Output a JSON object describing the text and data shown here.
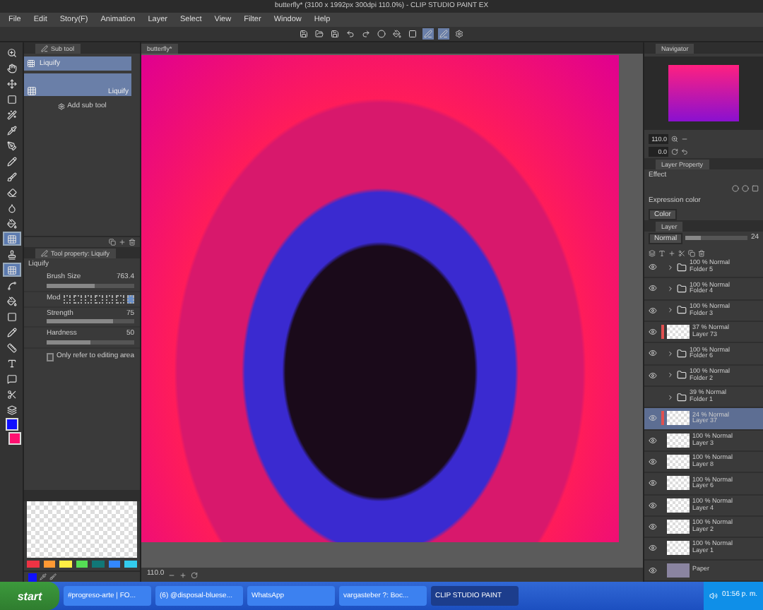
{
  "window": {
    "title": "butterfly* (3100 x 1992px 300dpi 110.0%) - CLIP STUDIO PAINT EX"
  },
  "menu": [
    "File",
    "Edit",
    "Story(F)",
    "Animation",
    "Layer",
    "Select",
    "View",
    "Filter",
    "Window",
    "Help"
  ],
  "tools": [
    {
      "selected": false
    },
    {
      "selected": false
    },
    {
      "selected": false
    },
    {
      "selected": false
    },
    {
      "selected": false
    },
    {
      "selected": false
    },
    {
      "selected": false
    },
    {
      "selected": false
    },
    {
      "selected": false
    },
    {
      "selected": false
    },
    {
      "selected": false
    },
    {
      "selected": false
    },
    {
      "selected": true
    },
    {
      "selected": false
    },
    {
      "selected": true
    },
    {
      "selected": false
    },
    {
      "selected": false
    },
    {
      "selected": false
    },
    {
      "selected": false
    },
    {
      "selected": false
    },
    {
      "selected": false
    },
    {
      "selected": false
    },
    {
      "selected": false
    },
    {
      "selected": false
    }
  ],
  "color_swatches": [
    {
      "kind": "main",
      "color": "#1010ff"
    },
    {
      "kind": "sub",
      "color": "#ff1070"
    }
  ],
  "sub_tool": {
    "tab": "Sub tool",
    "items": [
      {
        "kind": "row",
        "label": "Liquify",
        "selected": true
      },
      {
        "kind": "large",
        "label": "Liquify",
        "selected": true
      }
    ],
    "add_label": "Add sub tool"
  },
  "tool_property": {
    "tab": "Tool property: Liquify",
    "name": "Liquify",
    "properties": [
      {
        "kind": "slider",
        "label": "Brush Size",
        "value": "763.4",
        "level": 0.55
      },
      {
        "kind": "modes",
        "label": "Mod",
        "modes": [
          {
            "selected": false
          },
          {
            "selected": false
          },
          {
            "selected": false
          },
          {
            "selected": false
          },
          {
            "selected": false
          },
          {
            "selected": false
          },
          {
            "selected": true
          }
        ]
      },
      {
        "kind": "slider",
        "label": "Strength",
        "value": "75",
        "level": 0.75
      },
      {
        "kind": "slider",
        "label": "Hardness",
        "value": "50",
        "level": 0.5
      }
    ],
    "option": {
      "label": "Only refer to editing area",
      "checked": false
    }
  },
  "palette": {
    "colors": [
      {
        "color": "#ee3344"
      },
      {
        "color": "#ff9933"
      },
      {
        "color": "#ffee44"
      },
      {
        "color": "#55dd55"
      },
      {
        "color": "#117777"
      },
      {
        "color": "#3388ff"
      },
      {
        "color": "#33ccee"
      }
    ],
    "current": {
      "color": "#1010ff"
    }
  },
  "canvas": {
    "tab": "butterfly*",
    "zoom": "110.0"
  },
  "navigator": {
    "tab": "Navigator",
    "zoom": "110.0",
    "rotation": "0.0"
  },
  "layer_property": {
    "tab": "Layer Property",
    "effect_label": "Effect",
    "expression_label": "Expression color",
    "expression_value": "Color"
  },
  "layer_panel": {
    "tab": "Layer",
    "blend_mode": "Normal",
    "opacity": {
      "level": 0.24,
      "reading": "24"
    },
    "layers": [
      {
        "kind": "folder",
        "mode": "100 % Normal",
        "name": "Folder 5",
        "visible": true,
        "selected": false,
        "marked": false
      },
      {
        "kind": "folder",
        "mode": "100 % Normal",
        "name": "Folder 4",
        "visible": true,
        "selected": false,
        "marked": false
      },
      {
        "kind": "folder",
        "mode": "100 % Normal",
        "name": "Folder 3",
        "visible": true,
        "selected": false,
        "marked": false
      },
      {
        "kind": "layer",
        "mode": "37 % Normal",
        "name": "Layer 73",
        "visible": true,
        "selected": false,
        "marked": true
      },
      {
        "kind": "folder",
        "mode": "100 % Normal",
        "name": "Folder 6",
        "visible": true,
        "selected": false,
        "marked": false
      },
      {
        "kind": "folder",
        "mode": "100 % Normal",
        "name": "Folder 2",
        "visible": true,
        "selected": false,
        "marked": false
      },
      {
        "kind": "folder",
        "mode": "39 % Normal",
        "name": "Folder 1",
        "visible": false,
        "selected": false,
        "marked": false
      },
      {
        "kind": "layer",
        "mode": "24 % Normal",
        "name": "Layer 37",
        "visible": true,
        "selected": true,
        "marked": true
      },
      {
        "kind": "layer",
        "mode": "100 % Normal",
        "name": "Layer 3",
        "visible": true,
        "selected": false,
        "marked": false
      },
      {
        "kind": "layer",
        "mode": "100 % Normal",
        "name": "Layer 8",
        "visible": true,
        "selected": false,
        "marked": false
      },
      {
        "kind": "layer",
        "mode": "100 % Normal",
        "name": "Layer 6",
        "visible": true,
        "selected": false,
        "marked": false
      },
      {
        "kind": "layer",
        "mode": "100 % Normal",
        "name": "Layer 4",
        "visible": true,
        "selected": false,
        "marked": false
      },
      {
        "kind": "layer",
        "mode": "100 % Normal",
        "name": "Layer 2",
        "visible": true,
        "selected": false,
        "marked": false
      },
      {
        "kind": "layer",
        "mode": "100 % Normal",
        "name": "Layer 1",
        "visible": true,
        "selected": false,
        "marked": false
      },
      {
        "kind": "paper",
        "name": "Paper",
        "visible": true,
        "selected": false,
        "marked": false
      }
    ]
  },
  "taskbar": {
    "start": "start",
    "tasks": [
      {
        "label": "#progreso-arte | FO...",
        "selected": false
      },
      {
        "label": "(6) @disposal-bluese...",
        "selected": false
      },
      {
        "label": "WhatsApp",
        "selected": false
      },
      {
        "label": "vargasteber ?: Boc...",
        "selected": false
      },
      {
        "label": "CLIP STUDIO PAINT",
        "selected": true
      }
    ],
    "time": "01:56 p. m."
  }
}
